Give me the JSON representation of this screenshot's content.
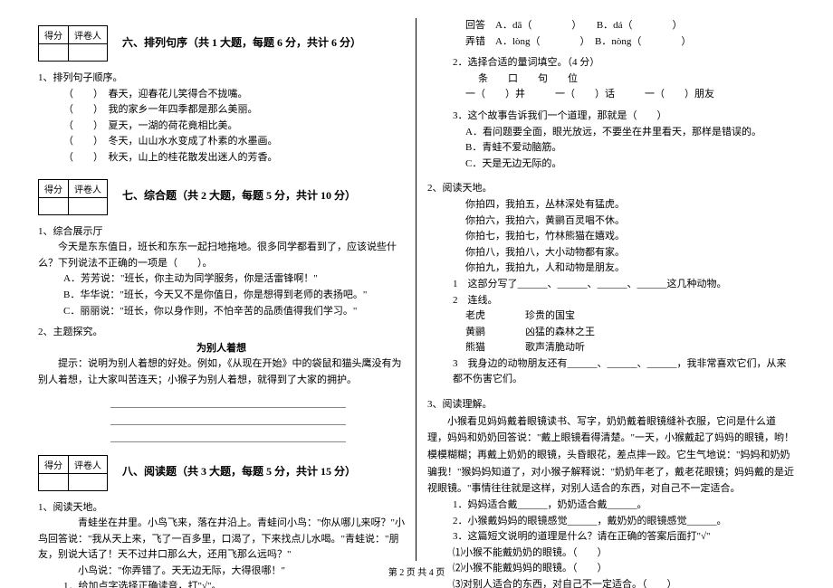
{
  "score_header": {
    "grade": "得分",
    "reviewer": "评卷人"
  },
  "sec6": {
    "title": "六、排列句序（共 1 大题，每题 6 分，共计 6 分）",
    "q1": "1、排列句子顺序。",
    "lines": [
      "（　　）　春天，迎春花儿笑得合不拢嘴。",
      "（　　）　我的家乡一年四季都是那么美丽。",
      "（　　）　夏天，一湖的荷花竟相比美。",
      "（　　）　冬天，山山水水变成了朴素的水墨画。",
      "（　　）　秋天，山上的桂花散发出迷人的芳香。"
    ]
  },
  "sec7": {
    "title": "七、综合题（共 2 大题，每题 5 分，共计 10 分）",
    "q1": "1、综合展示厅",
    "q1_body": "　　今天是东东值日，班长和东东一起扫地拖地。很多同学都看到了，应该说些什么？下列说法不正确的一项是（　　）。",
    "q1_opts": [
      "A．芳芳说：\"班长，你主动为同学服务，你是活雷锋啊！\"",
      "B．华华说：\"班长，今天又不是你值日，你是想得到老师的表扬吧。\"",
      "C．丽丽说：\"班长，你以身作则，不怕辛苦的品质值得我们学习。\""
    ],
    "q2": "2、主题探究。",
    "q2_sub": "为别人着想",
    "q2_body": "　　提示：说明为别人着想的好处。例如，《从现在开始》中的袋鼠和猫头鹰没有为别人着想，让大家叫苦连天；小猴子为别人着想，就得到了大家的拥护。"
  },
  "sec8": {
    "title": "八、阅读题（共 3 大题，每题 5 分，共计 15 分）",
    "q1": "1、阅读天地。",
    "q1_body": [
      "　　　　青蛙坐在井里。小鸟飞来，落在井沿上。青蛙问小鸟：\"你从哪儿来呀？\"小鸟回答说：\"我从天上来，飞了一百多里，口渴了，下来找点儿水喝。\"青蛙说：\"朋友，别说大话了！天不过井口那么大，还用飞那么远吗？\"",
      "　　　　小鸟说：\"你弄错了。天无边无际，大得很哪！\""
    ],
    "q1_1": "1．给加点字选择正确读音，打\"√\"。",
    "q1_1_items": [
      "回答　A．dā（　　　　）　　B．dá（　　　　）",
      "弄错　A．lòng（　　　　）　B．nòng（　　　　）"
    ],
    "q1_2": "2．选择合适的量词填空。（4 分）",
    "q1_2_words": "条　　口　　句　　位",
    "q1_2_blanks": "一（　　）井　　　一（　　）话　　　一（　　）朋友",
    "q1_3": "3．这个故事告诉我们一个道理，那就是（　　）",
    "q1_3_opts": [
      "A．看问题要全面，眼光放远，不要坐在井里看天，那样是错误的。",
      "B．青蛙不爱动脑筋。",
      "C．天是无边无际的。"
    ],
    "q2": "2、阅读天地。",
    "q2_body": [
      "你拍四，我拍五，丛林深处有猛虎。",
      "你拍六，我拍六，黄鹂百灵唱不休。",
      "你拍七，我拍七，竹林熊猫在嬉戏。",
      "你拍八，我拍八，大小动物都有家。",
      "你拍九，我拍九，人和动物是朋友。"
    ],
    "q2_1": "1　这部分写了______、______、______、______这几种动物。",
    "q2_2": "2　连线。",
    "q2_2_pairs": [
      "老虎　　　　珍贵的国宝",
      "黄鹂　　　　凶猛的森林之王",
      "熊猫　　　　歌声清脆动听"
    ],
    "q2_3": "3　我身边的动物朋友还有______、______、______，我非常喜欢它们，从来都不伤害它们。",
    "q3": "3、阅读理解。",
    "q3_body": "　　小猴看见妈妈戴着眼镜读书、写字，奶奶戴着眼镜缝补衣服，它问是什么道理，妈妈和奶奶回答说：\"戴上眼镜看得清楚。\"一天，小猴戴起了妈妈的眼镜，哟！模模糊糊；再戴上奶奶的眼镜，头昏眼花，差点摔一跤。它生气地说：\"妈妈和奶奶骗我！\"猴妈妈知道了，对小猴子解释说：\"奶奶年老了，戴老花眼镜；妈妈戴的是近视眼镜。\"事情往往就是这样，对别人适合的东西，对自己不一定适合。",
    "q3_1": "1．妈妈适合戴______，奶奶适合戴______。",
    "q3_2": "2．小猴戴妈妈的眼镜感觉______，戴奶奶的眼镜感觉______。",
    "q3_3": "3．这篇短文说明的道理是什么？请在正确的答案后面打\"√\"",
    "q3_3_opts": [
      "⑴小猴不能戴奶奶的眼镜。（　　）",
      "⑵小猴不能戴妈妈的眼镜。（　　）",
      "⑶对别人适合的东西，对自己不一定适合。（　　）"
    ]
  },
  "footer": "第 2 页 共 4 页"
}
